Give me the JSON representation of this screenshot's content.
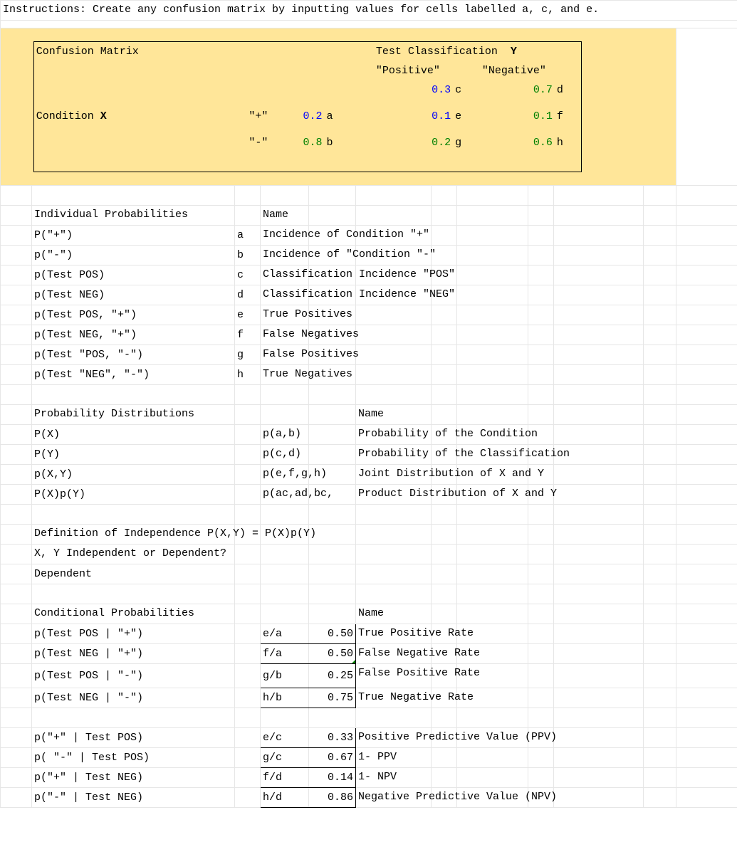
{
  "instructions": "Instructions: Create any confusion matrix by inputting values for cells labelled a, c, and e.",
  "matrix": {
    "title": "Confusion Matrix",
    "testHeader": "Test Classification",
    "testBoldY": "Y",
    "posLabel": "\"Positive\"",
    "negLabel": "\"Negative\"",
    "conditionLabel": "Condition",
    "conditionBoldX": "X",
    "rowPlus": "\"+\"",
    "rowMinus": "\"-\"",
    "a": "0.2",
    "aL": "a",
    "b": "0.8",
    "bL": "b",
    "c": "0.3",
    "cL": "c",
    "d": "0.7",
    "dL": "d",
    "e": "0.1",
    "eL": "e",
    "f": "0.1",
    "fL": "f",
    "g": "0.2",
    "gL": "g",
    "h": "0.6",
    "hL": "h"
  },
  "indiv": {
    "header": "Individual Probabilities",
    "nameHeader": "Name",
    "rows": [
      {
        "p": "P(\"+\")",
        "l": "a",
        "n": "Incidence of Condition \"+\""
      },
      {
        "p": "p(\"-\")",
        "l": "b",
        "n": "Incidence of \"Condition \"-\""
      },
      {
        "p": "p(Test POS)",
        "l": "c",
        "n": "Classification Incidence \"POS\""
      },
      {
        "p": "p(Test NEG)",
        "l": "d",
        "n": "Classification Incidence \"NEG\""
      },
      {
        "p": "p(Test POS, \"+\")",
        "l": "e",
        "n": "True Positives"
      },
      {
        "p": "p(Test NEG, \"+\")",
        "l": "f",
        "n": "False Negatives"
      },
      {
        "p": "p(Test \"POS, \"-\")",
        "l": "g",
        "n": "False Positives"
      },
      {
        "p": "p(Test \"NEG\", \"-\")",
        "l": "h",
        "n": "True Negatives"
      }
    ]
  },
  "dist": {
    "header": "Probability Distributions",
    "nameHeader": "Name",
    "rows": [
      {
        "p": "P(X)",
        "f": "p(a,b)",
        "n": "Probability of the Condition"
      },
      {
        "p": "P(Y)",
        "f": "p(c,d)",
        "n": "Probability of the Classification"
      },
      {
        "p": "p(X,Y)",
        "f": "p(e,f,g,h)",
        "n": "Joint Distribution of X and Y"
      },
      {
        "p": "P(X)p(Y)",
        "f": "p(ac,ad,bc,",
        "n": "Product Distribution of X and Y"
      }
    ]
  },
  "indep": {
    "def": "Definition of Independence P(X,Y) = P(X)p(Y)",
    "q": "X, Y Independent or Dependent?",
    "a": "Dependent"
  },
  "cond": {
    "header": "Conditional Probabilities",
    "nameHeader": "Name",
    "rows": [
      {
        "p": "p(Test POS | \"+\")",
        "f": "e/a",
        "v": "0.50",
        "n": "True Positive Rate"
      },
      {
        "p": "p(Test NEG | \"+\")",
        "f": "f/a",
        "v": "0.50",
        "n": "False Negative Rate",
        "tri": true
      },
      {
        "p": "p(Test POS | \"-\")",
        "f": "g/b",
        "v": "0.25",
        "n": "False Positive Rate",
        "tall": true
      },
      {
        "p": "p(Test NEG | \"-\")",
        "f": "h/b",
        "v": "0.75",
        "n": "True Negative Rate"
      },
      {
        "gap": true
      },
      {
        "p": "p(\"+\" | Test POS)",
        "f": "e/c",
        "v": "0.33",
        "n": "Positive Predictive Value (PPV)"
      },
      {
        "p": "p( \"-\" | Test POS)",
        "f": "g/c",
        "v": "0.67",
        "n": "1- PPV"
      },
      {
        "p": "p(\"+\" | Test NEG)",
        "f": "f/d",
        "v": "0.14",
        "n": "1- NPV"
      },
      {
        "p": "p(\"-\" | Test NEG)",
        "f": "h/d",
        "v": "0.86",
        "n": "Negative Predictive Value (NPV)"
      }
    ]
  }
}
